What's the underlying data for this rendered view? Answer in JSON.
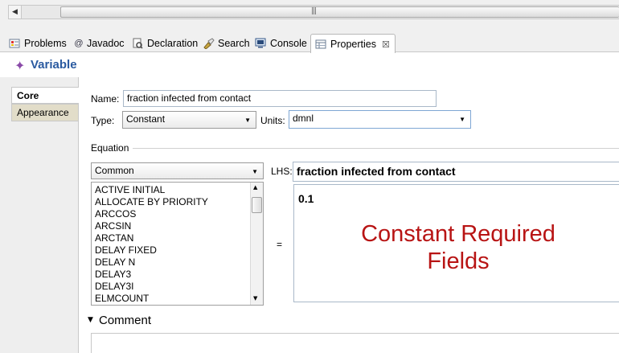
{
  "tabs": [
    {
      "label": "Problems",
      "icon": "problems-icon"
    },
    {
      "label": "Javadoc",
      "icon": "at-sign-icon"
    },
    {
      "label": "Declaration",
      "icon": "declaration-icon"
    },
    {
      "label": "Search",
      "icon": "flashlight-icon"
    },
    {
      "label": "Console",
      "icon": "console-icon"
    },
    {
      "label": "Properties",
      "icon": "properties-icon",
      "active": true
    }
  ],
  "view": {
    "title": "Variable",
    "icon": "variable-icon"
  },
  "side_tabs": [
    {
      "label": "Core",
      "selected": true
    },
    {
      "label": "Appearance",
      "selected": false
    }
  ],
  "form": {
    "name_label": "Name:",
    "name_value": "fraction infected from contact",
    "type_label": "Type:",
    "type_value": "Constant",
    "units_label": "Units:",
    "units_value": "dmnl",
    "equation_label": "Equation",
    "function_group": "Common",
    "lhs_label": "LHS:",
    "lhs_value": "fraction infected from contact",
    "equals": "=",
    "equation_value": "0.1",
    "comment_label": "Comment"
  },
  "functions": [
    "ACTIVE INITIAL",
    "ALLOCATE BY PRIORITY",
    "ARCCOS",
    "ARCSIN",
    "ARCTAN",
    "DELAY FIXED",
    "DELAY N",
    "DELAY3",
    "DELAY3I",
    "ELMCOUNT"
  ],
  "annotation": {
    "line1": "Constant Required",
    "line2": "Fields",
    "color": "#b81414"
  },
  "colors": {
    "title": "#2a5aa0",
    "selected_side_tab": "#ffffff",
    "unselected_side_tab": "#e2ddc9"
  }
}
